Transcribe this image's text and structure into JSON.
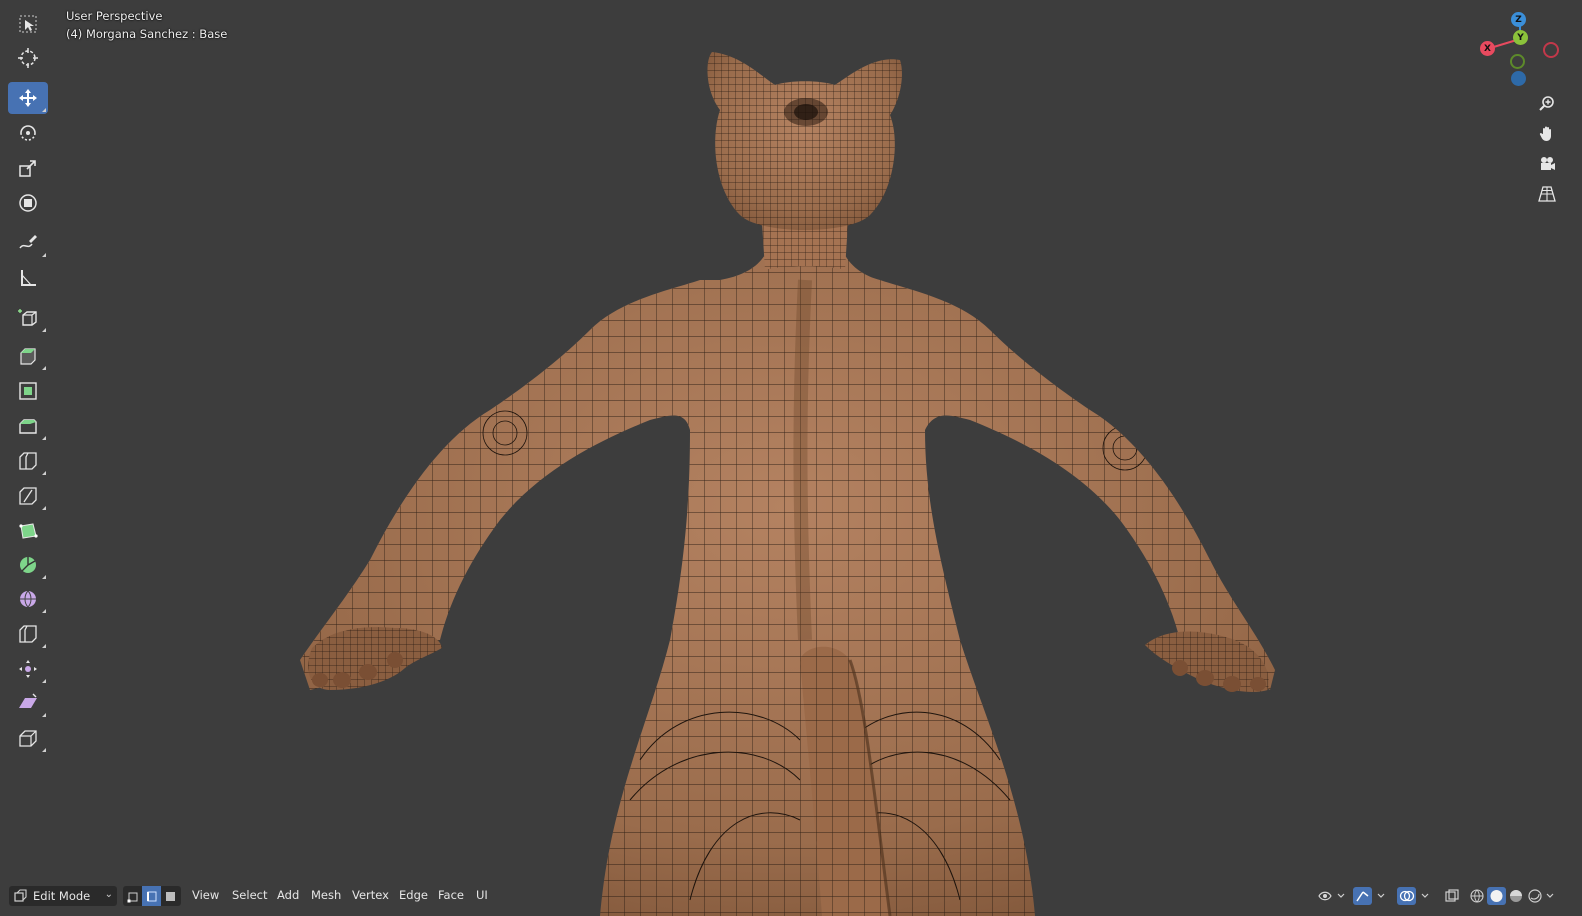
{
  "viewport": {
    "perspective_label": "User Perspective",
    "object_label": "(4) Morgana Sanchez : Base"
  },
  "toolbar": {
    "tools": [
      {
        "name": "select-box-tool",
        "icon": "select-box-icon",
        "active": false
      },
      {
        "name": "cursor-tool",
        "icon": "cursor-icon",
        "active": false
      },
      {
        "name": "move-tool",
        "icon": "move-icon",
        "active": true
      },
      {
        "name": "rotate-tool",
        "icon": "rotate-icon",
        "active": false
      },
      {
        "name": "scale-tool",
        "icon": "scale-icon",
        "active": false
      },
      {
        "name": "transform-tool",
        "icon": "transform-icon",
        "active": false
      },
      {
        "name": "annotate-tool",
        "icon": "annotate-icon",
        "active": false
      },
      {
        "name": "measure-tool",
        "icon": "measure-icon",
        "active": false
      },
      {
        "name": "add-cube-tool",
        "icon": "add-cube-icon",
        "active": false
      },
      {
        "name": "extrude-tool",
        "icon": "extrude-icon",
        "active": false
      },
      {
        "name": "inset-tool",
        "icon": "inset-icon",
        "active": false
      },
      {
        "name": "bevel-tool",
        "icon": "bevel-icon",
        "active": false
      },
      {
        "name": "loop-cut-tool",
        "icon": "loop-cut-icon",
        "active": false
      },
      {
        "name": "knife-tool",
        "icon": "knife-icon",
        "active": false
      },
      {
        "name": "poly-build-tool",
        "icon": "poly-build-icon",
        "active": false
      },
      {
        "name": "spin-tool",
        "icon": "spin-icon",
        "active": false
      },
      {
        "name": "smooth-tool",
        "icon": "smooth-icon",
        "active": false
      },
      {
        "name": "edge-slide-tool",
        "icon": "edge-slide-icon",
        "active": false
      },
      {
        "name": "shrink-fatten-tool",
        "icon": "shrink-fatten-icon",
        "active": false
      },
      {
        "name": "shear-tool",
        "icon": "shear-icon",
        "active": false
      },
      {
        "name": "rip-region-tool",
        "icon": "rip-region-icon",
        "active": false
      }
    ]
  },
  "gizmo": {
    "z_label": "Z",
    "y_label": "Y",
    "x_label": "X",
    "x_color": "#e84a5f",
    "y_color": "#8bc33b",
    "z_color": "#3b8fd9"
  },
  "nav_buttons": [
    {
      "name": "zoom-button",
      "icon": "zoom-in-icon"
    },
    {
      "name": "pan-button",
      "icon": "hand-icon"
    },
    {
      "name": "camera-view-button",
      "icon": "camera-icon"
    },
    {
      "name": "perspective-toggle-button",
      "icon": "grid-icon"
    }
  ],
  "header": {
    "mode": "Edit Mode",
    "menus": [
      "View",
      "Select",
      "Add",
      "Mesh",
      "Vertex",
      "Edge",
      "Face",
      "UI"
    ]
  },
  "colors": {
    "background": "#3d3d3d",
    "skin": "#a67654",
    "wire": "#1e140d",
    "accent": "#4772b3"
  }
}
